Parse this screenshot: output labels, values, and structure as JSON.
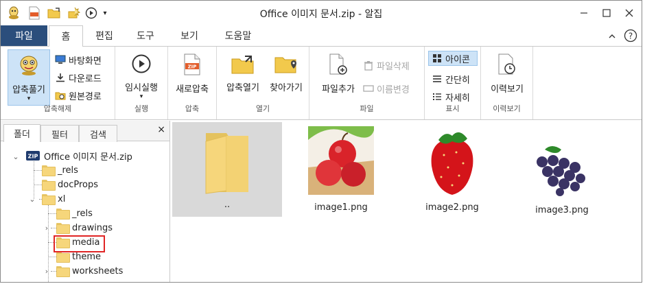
{
  "window": {
    "title": "Office 이미지 문서.zip - 알집",
    "controls": [
      "minimize",
      "maximize",
      "close"
    ]
  },
  "quick_access": {
    "icons": [
      "alzip-logo-icon",
      "zip-file-icon",
      "folder-open-icon",
      "wand-icon",
      "play-circle-icon",
      "dropdown-arrow-icon"
    ]
  },
  "tabs": {
    "file": "파일",
    "items": [
      "홈",
      "편집",
      "도구",
      "보기",
      "도움말"
    ],
    "active": "홈"
  },
  "ribbon": {
    "extract_group": {
      "label": "압축해제",
      "extract": "압축풀기",
      "desktop": "바탕화면",
      "download": "다운로드",
      "original_path": "원본경로"
    },
    "run_group": {
      "label": "실행",
      "temp_run": "임시실행"
    },
    "compress_group": {
      "label": "압축",
      "new_compress": "새로압축"
    },
    "open_group": {
      "label": "열기",
      "open_archive": "압축열기",
      "goto": "찾아가기"
    },
    "file_group": {
      "label": "파일",
      "add_file": "파일추가",
      "delete_file": "파일삭제",
      "rename": "이름변경"
    },
    "view_group": {
      "label": "표시",
      "icon": "아이콘",
      "simple": "간단히",
      "detail": "자세히"
    },
    "history_group": {
      "label": "이력보기",
      "history": "이력보기"
    }
  },
  "left_panel": {
    "tabs": [
      "폴더",
      "필터",
      "검색"
    ],
    "active_tab": "폴더",
    "close": "×",
    "tree": {
      "root": "Office 이미지 문서.zip",
      "items": [
        "_rels",
        "docProps",
        "xl",
        "_rels",
        "drawings",
        "media",
        "theme",
        "worksheets"
      ],
      "selected": "media"
    }
  },
  "main": {
    "items": [
      {
        "name": "..",
        "type": "folder"
      },
      {
        "name": "image1.png",
        "type": "image",
        "subject": "apples"
      },
      {
        "name": "image2.png",
        "type": "image",
        "subject": "strawberry"
      },
      {
        "name": "image3.png",
        "type": "image",
        "subject": "grapes"
      }
    ]
  },
  "colors": {
    "file_tab": "#2b4e7c",
    "selection": "#cde3f7",
    "folder": "#f6d67b",
    "highlight_box": "#e02424"
  }
}
